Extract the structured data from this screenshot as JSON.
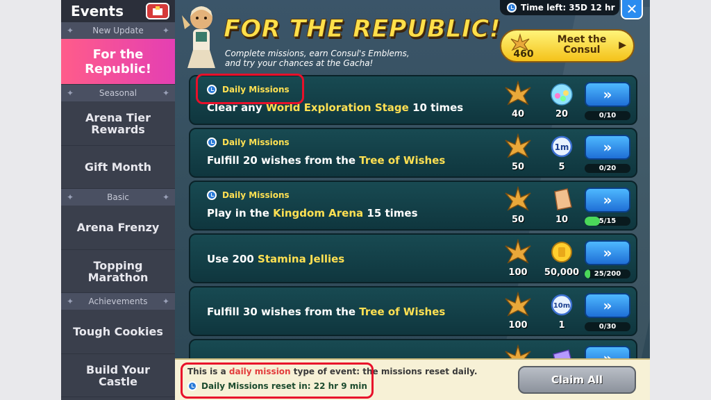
{
  "sidebar": {
    "title": "Events",
    "sections": [
      {
        "header": "New Update",
        "items": [
          "For the Republic!"
        ]
      },
      {
        "header": "Seasonal",
        "items": [
          "Arena Tier Rewards",
          "Gift Month"
        ]
      },
      {
        "header": "Basic",
        "items": [
          "Arena Frenzy",
          "Topping Marathon"
        ]
      },
      {
        "header": "Achievements",
        "items": [
          "Tough Cookies",
          "Build Your Castle"
        ]
      }
    ]
  },
  "header": {
    "title": "FOR THE REPUBLIC!",
    "subtitle_line1": "Complete missions, earn Consul's Emblems,",
    "subtitle_line2": "and try your chances at the Gacha!",
    "time_left": "Time left: 35D 12 hr",
    "consul_count": "460",
    "consul_label_line1": "Meet the",
    "consul_label_line2": "Consul"
  },
  "missions": [
    {
      "tag": "Daily Missions",
      "pre": "Clear any ",
      "hl": "World Exploration Stage",
      "post": " 10 times",
      "emblems": "40",
      "reward_icon": "gem-icon",
      "reward_qty": "20",
      "progress": "0/10",
      "progress_fraction": 0
    },
    {
      "tag": "Daily Missions",
      "pre": "Fulfill 20 wishes from the ",
      "hl": "Tree of Wishes",
      "post": "",
      "emblems": "50",
      "reward_icon": "speedup-1m-icon",
      "reward_qty": "5",
      "progress": "0/20",
      "progress_fraction": 0
    },
    {
      "tag": "Daily Missions",
      "pre": "Play in the ",
      "hl": "Kingdom Arena",
      "post": " 15 times",
      "emblems": "50",
      "reward_icon": "cookie-cutter-icon",
      "reward_qty": "10",
      "progress": "5/15",
      "progress_fraction": 0.333
    },
    {
      "tag": "",
      "pre": "Use 200 ",
      "hl": "Stamina Jellies",
      "post": "",
      "emblems": "100",
      "reward_icon": "coin-icon",
      "reward_qty": "50,000",
      "progress": "25/200",
      "progress_fraction": 0.125
    },
    {
      "tag": "",
      "pre": "Fulfill 30 wishes from the ",
      "hl": "Tree of Wishes",
      "post": "",
      "emblems": "100",
      "reward_icon": "speedup-10m-icon",
      "reward_qty": "1",
      "progress": "0/30",
      "progress_fraction": 0
    }
  ],
  "footer": {
    "note_pre": "This is a ",
    "note_red": "daily mission",
    "note_post": " type of event: the missions reset daily.",
    "reset_text": "Daily Missions reset in: 22 hr 9 min",
    "claim_all": "Claim All"
  },
  "colors": {
    "highlight": "#ffe052",
    "active_tab": "#e43fb3",
    "annotation_box": "#e8102a"
  }
}
